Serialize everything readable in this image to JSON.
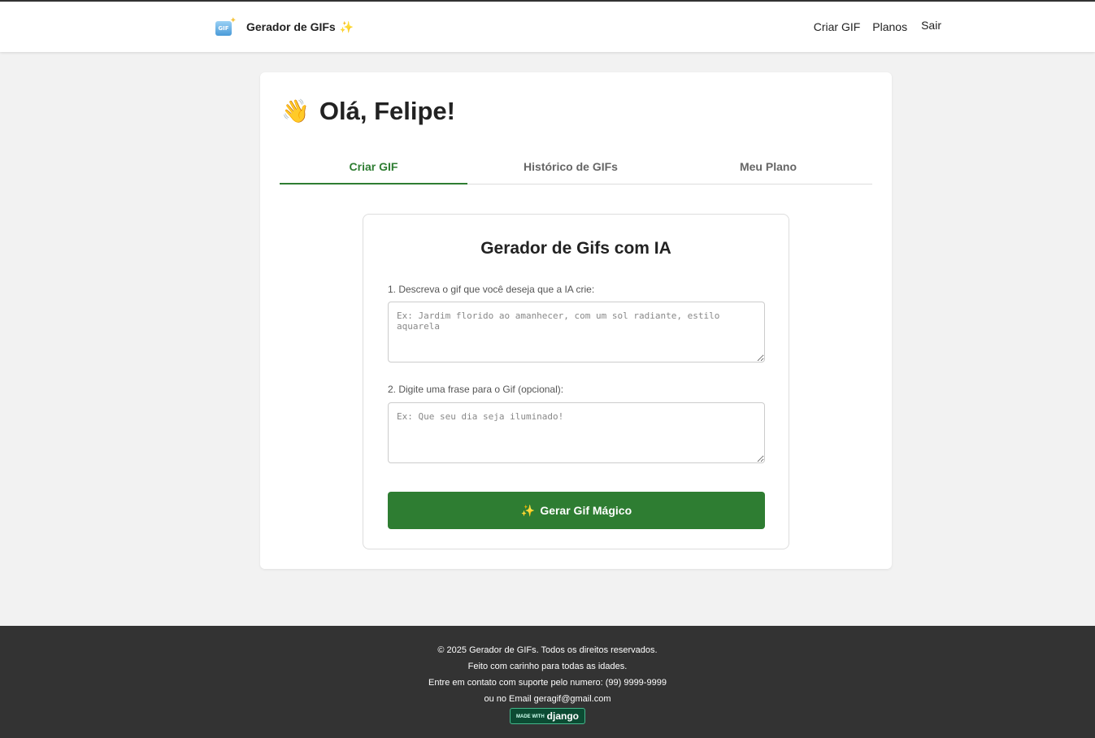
{
  "header": {
    "brand_title": "Gerador de GIFs",
    "brand_logo_text": "GIF",
    "nav": {
      "criar_gif": "Criar GIF",
      "planos": "Planos",
      "sair": "Sair"
    }
  },
  "greeting": {
    "emoji": "👋",
    "text": "Olá, Felipe!"
  },
  "tabs": [
    {
      "label": "Criar GIF",
      "active": true
    },
    {
      "label": "Histórico de GIFs",
      "active": false
    },
    {
      "label": "Meu Plano",
      "active": false
    }
  ],
  "form": {
    "title": "Gerador de Gifs com IA",
    "description_label": "1. Descreva o gif que você deseja que a IA crie:",
    "description_placeholder": "Ex: Jardim florido ao amanhecer, com um sol radiante, estilo aquarela",
    "phrase_label": "2. Digite uma frase para o Gif (opcional):",
    "phrase_placeholder": "Ex: Que seu dia seja iluminado!",
    "submit_label": "Gerar Gif Mágico"
  },
  "footer": {
    "copyright": "© 2025 Gerador de GIFs. Todos os direitos reservados.",
    "tagline": "Feito com carinho para todas as idades.",
    "contact_phone": "Entre em contato com suporte pelo numero: (99) 9999-9999",
    "contact_email": "ou no Email geragif@gmail.com",
    "badge_small": "MADE WITH",
    "badge_main": "django"
  },
  "colors": {
    "accent": "#2e7d32",
    "footer_bg": "#333333",
    "page_bg": "#f2f2f2"
  }
}
